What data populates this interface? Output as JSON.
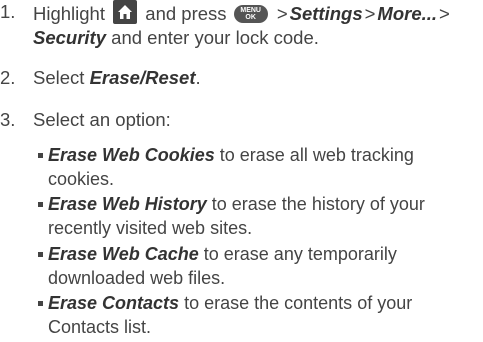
{
  "steps": [
    {
      "number": "1.",
      "parts": {
        "highlight": "Highlight",
        "and_press": "and press",
        "gt1": ">",
        "settings": "Settings",
        "gt2": ">",
        "more": "More...",
        "gt3": ">",
        "security": "Security",
        "tail": "and enter your lock code."
      },
      "icons": {
        "home": "home-icon",
        "menu": "menu-ok-key-icon",
        "menu_line1": "MENU",
        "menu_line2": "OK"
      }
    },
    {
      "number": "2.",
      "parts": {
        "select": "Select",
        "erase_reset": "Erase/Reset",
        "period": "."
      }
    },
    {
      "number": "3.",
      "parts": {
        "text": "Select an option:"
      }
    }
  ],
  "options": [
    {
      "label": "Erase Web Cookies",
      "description_line1": "to erase all web tracking",
      "description_line2": "cookies."
    },
    {
      "label": "Erase Web History",
      "description_line1": "to erase the history of your",
      "description_line2": "recently visited web sites."
    },
    {
      "label": "Erase Web Cache",
      "description_line1": "to erase any temporarily",
      "description_line2": "downloaded web files."
    },
    {
      "label": "Erase Contacts",
      "description_line1": "to erase the contents of your",
      "description_line2": "Contacts list."
    }
  ]
}
